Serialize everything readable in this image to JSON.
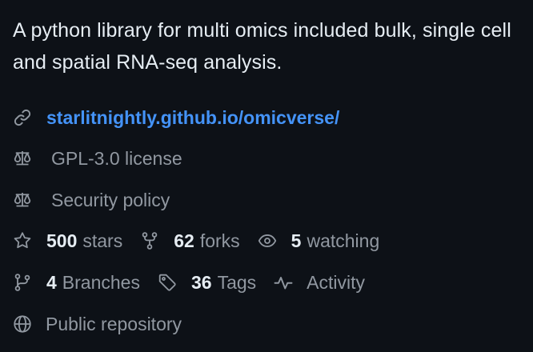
{
  "about": {
    "description": "A python library for multi omics included bulk, single cell and spatial RNA-seq analysis."
  },
  "links": {
    "website": "starlitnightly.github.io/omicverse/"
  },
  "license": {
    "label": "GPL-3.0 license"
  },
  "security": {
    "label": "Security policy"
  },
  "stats": {
    "stars": {
      "count": "500",
      "label": "stars"
    },
    "forks": {
      "count": "62",
      "label": "forks"
    },
    "watching": {
      "count": "5",
      "label": "watching"
    }
  },
  "refs": {
    "branches": {
      "count": "4",
      "label": "Branches"
    },
    "tags": {
      "count": "36",
      "label": "Tags"
    },
    "activity": {
      "label": "Activity"
    }
  },
  "visibility": {
    "label": "Public repository"
  },
  "icons": {
    "link": "link-icon",
    "license": "scale-icon",
    "security": "scale-icon",
    "star": "star-icon",
    "fork": "fork-icon",
    "eye": "eye-icon",
    "branch": "branch-icon",
    "tag": "tag-icon",
    "activity": "pulse-icon",
    "globe": "globe-icon"
  },
  "colors": {
    "background": "#0d1117",
    "text": "#e6edf3",
    "muted": "#9198a1",
    "link": "#4493f8"
  }
}
